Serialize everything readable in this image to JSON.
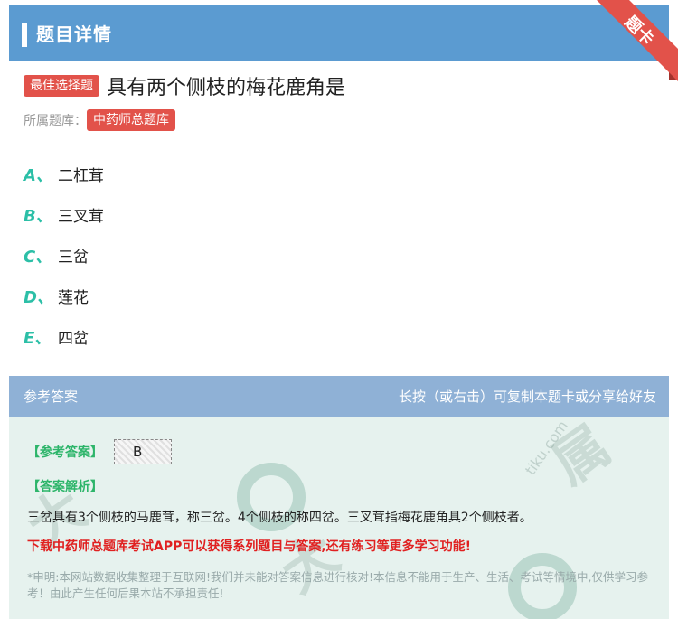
{
  "header": {
    "title": "题目详情"
  },
  "ribbon": {
    "text": "题卡"
  },
  "question": {
    "type_tag": "最佳选择题",
    "text": "具有两个侧枝的梅花鹿角是",
    "bank_label": "所属题库：",
    "bank_name": "中药师总题库"
  },
  "options": [
    {
      "letter": "A、",
      "text": "二杠茸"
    },
    {
      "letter": "B、",
      "text": "三叉茸"
    },
    {
      "letter": "C、",
      "text": "三岔"
    },
    {
      "letter": "D、",
      "text": "莲花"
    },
    {
      "letter": "E、",
      "text": "四岔"
    }
  ],
  "answer": {
    "header_left": "参考答案",
    "header_right": "长按（或右击）可复制本题卡或分享给好友",
    "key_label": "【参考答案】",
    "key_value": "B",
    "analysis_label": "【答案解析】",
    "analysis_text": "三岔具有3个侧枝的马鹿茸，称三岔。4个侧枝的称四岔。三叉茸指梅花鹿角具2个侧枝者。",
    "promo": "下载中药师总题库考试APP可以获得系列题目与答案,还有练习等更多学习功能!",
    "disclaimer": "*申明:本网站数据收集整理于互联网!我们并未能对答案信息进行核对!本信息不能用于生产、生活、考试等情境中,仅供学习参考！由此产生任何后果本站不承担责任!"
  },
  "colors": {
    "header_bg": "#5b9bd1",
    "tag_red": "#e2524a",
    "option_letter": "#2cbfa7",
    "answer_green": "#2db56a",
    "promo_red": "#e02020"
  }
}
